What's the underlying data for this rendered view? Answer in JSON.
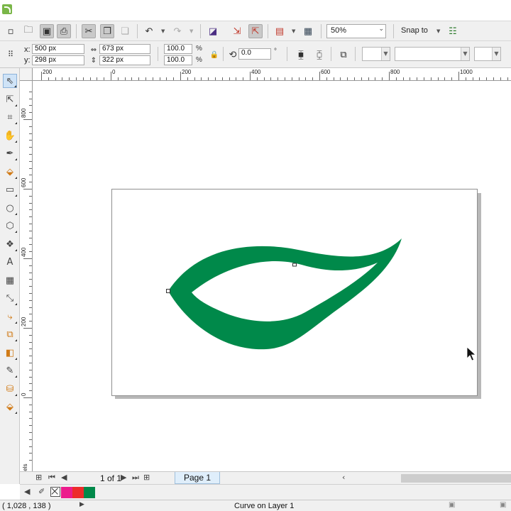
{
  "title_bar": {
    "title": ""
  },
  "toolbar": {
    "zoom_level": "50%",
    "snap_label": "Snap to",
    "icons": [
      "new-icon",
      "open-icon",
      "save-icon",
      "print-icon",
      "cut-icon",
      "copy-icon",
      "paste-icon",
      "undo-icon",
      "redo-icon",
      "search-content-icon",
      "import-icon",
      "export-icon",
      "publish-pdf-icon",
      "app-launcher-icon",
      "zoom-dropdown-icon",
      "options-icon"
    ]
  },
  "property_bar": {
    "x_label": "x:",
    "x_value": "500 px",
    "y_label": "y:",
    "y_value": "298 px",
    "width_value": "673 px",
    "height_value": "322 px",
    "scale_x": "100.0",
    "scale_y": "100.0",
    "percent_symbol": "%",
    "rotation_value": "0.0",
    "degree_symbol": "°"
  },
  "rulers": {
    "horizontal_labels": [
      "200",
      "0",
      "200",
      "400",
      "600",
      "800",
      "1000"
    ],
    "vertical_labels": [
      "800",
      "600",
      "400",
      "200",
      "0"
    ],
    "units": "pixels"
  },
  "tools": [
    "pick-tool",
    "shape-tool",
    "crop-tool",
    "zoom-tool",
    "freehand-tool",
    "smart-fill-tool",
    "rectangle-tool",
    "ellipse-tool",
    "polygon-tool",
    "text-tool",
    "table-tool",
    "dimension-tool",
    "connector-tool",
    "blend-tool",
    "transparency-tool",
    "eyedropper-tool",
    "fill-tool",
    "smart-fill-tool-2"
  ],
  "document": {
    "page_count": "1 of 1",
    "page_tab": "Page 1",
    "leaf_fill": "#00894a",
    "page_color": "#ffffff"
  },
  "palette": {
    "colors": [
      "#ec1c8c",
      "#ed2b2b",
      "#00894a"
    ]
  },
  "status": {
    "coords": "( 1,028 , 138  )",
    "selection_text": "Curve on Layer 1"
  }
}
